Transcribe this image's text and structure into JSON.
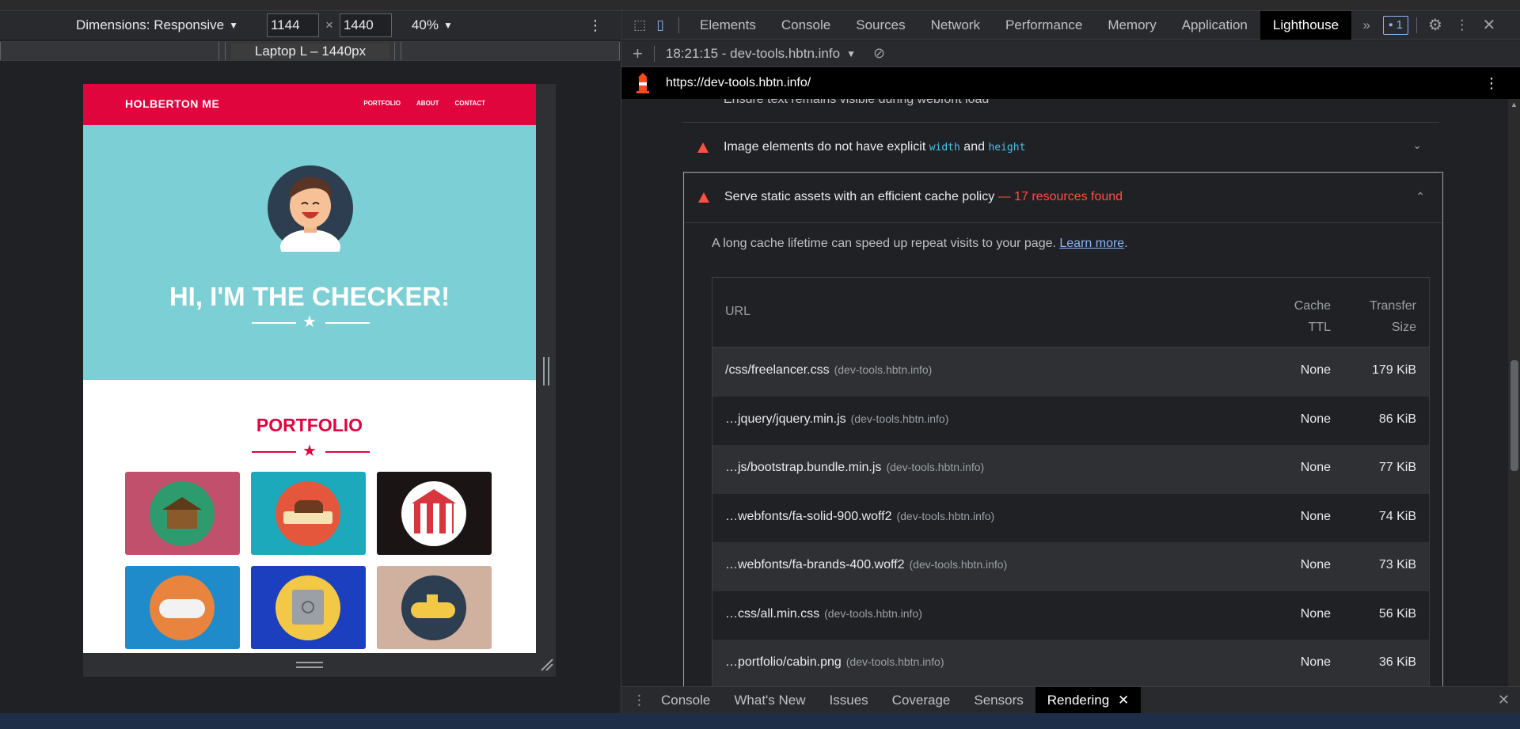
{
  "device_toolbar": {
    "dimensions_label": "Dimensions: Responsive",
    "width_value": "1144",
    "times": "×",
    "height_value": "1440",
    "zoom_label": "40%",
    "breakpoint_label": "Laptop L – 1440px"
  },
  "site": {
    "brand": "HOLBERTON ME",
    "nav": [
      "PORTFOLIO",
      "ABOUT",
      "CONTACT"
    ],
    "hero_title": "HI, I'M THE CHECKER!",
    "portfolio_title": "PORTFOLIO",
    "colors": {
      "nav": "#e0053d",
      "hero": "#7ccfd4"
    }
  },
  "devtools": {
    "tabs": [
      "Elements",
      "Console",
      "Sources",
      "Network",
      "Performance",
      "Memory",
      "Application",
      "Lighthouse"
    ],
    "active_tab": "Lighthouse",
    "issues_count": "1",
    "report_label": "18:21:15 - dev-tools.hbtn.info",
    "page_url": "https://dev-tools.hbtn.info/",
    "audits": {
      "partial_title": "Ensure text remains visible during webfont load",
      "img_title_pre": "Image elements do not have explicit ",
      "img_code_width": "width",
      "img_and": " and ",
      "img_code_height": "height",
      "cache_title": "Serve static assets with an efficient cache policy",
      "cache_found": " — 17 resources found",
      "cache_desc": "A long cache lifetime can speed up repeat visits to your page. ",
      "learn_more": "Learn more",
      "period": "."
    },
    "table": {
      "col_url": "URL",
      "col_ttl_1": "Cache",
      "col_ttl_2": "TTL",
      "col_size_1": "Transfer",
      "col_size_2": "Size",
      "rows": [
        {
          "url": "/css/freelancer.css",
          "host": "(dev-tools.hbtn.info)",
          "ttl": "None",
          "size": "179 KiB"
        },
        {
          "url": "…jquery/jquery.min.js",
          "host": "(dev-tools.hbtn.info)",
          "ttl": "None",
          "size": "86 KiB"
        },
        {
          "url": "…js/bootstrap.bundle.min.js",
          "host": "(dev-tools.hbtn.info)",
          "ttl": "None",
          "size": "77 KiB"
        },
        {
          "url": "…webfonts/fa-solid-900.woff2",
          "host": "(dev-tools.hbtn.info)",
          "ttl": "None",
          "size": "74 KiB"
        },
        {
          "url": "…webfonts/fa-brands-400.woff2",
          "host": "(dev-tools.hbtn.info)",
          "ttl": "None",
          "size": "73 KiB"
        },
        {
          "url": "…css/all.min.css",
          "host": "(dev-tools.hbtn.info)",
          "ttl": "None",
          "size": "56 KiB"
        },
        {
          "url": "…portfolio/cabin.png",
          "host": "(dev-tools.hbtn.info)",
          "ttl": "None",
          "size": "36 KiB"
        }
      ]
    },
    "drawer_tabs": [
      "Console",
      "What's New",
      "Issues",
      "Coverage",
      "Sensors",
      "Rendering"
    ],
    "drawer_active": "Rendering"
  }
}
